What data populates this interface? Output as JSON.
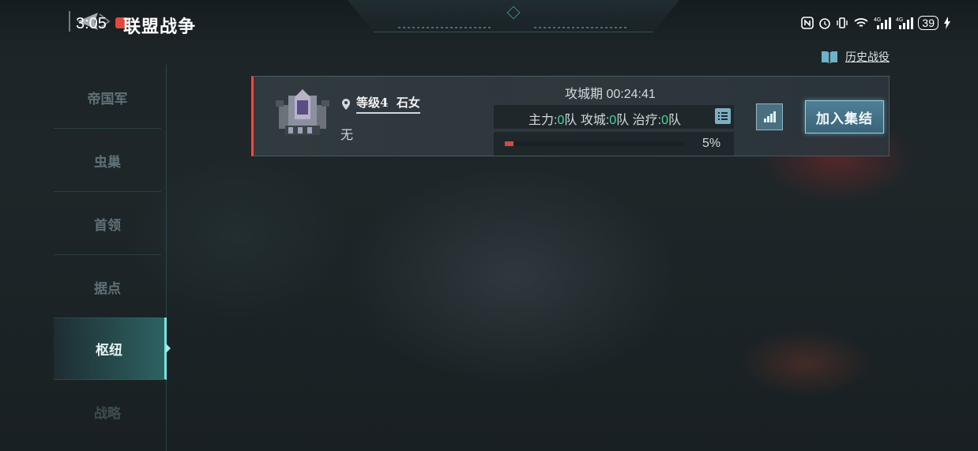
{
  "status_bar": {
    "time": "3:05",
    "battery": "39",
    "icons": [
      "nfc-icon",
      "alarm-icon",
      "vibrate-icon",
      "wifi-icon",
      "signal-4g-icon",
      "signal-4g-icon",
      "charging-icon"
    ]
  },
  "header": {
    "title": "联盟战争",
    "history_label": "历史战役"
  },
  "sidebar": {
    "items": [
      {
        "label": "帝国军",
        "active": false
      },
      {
        "label": "虫巢",
        "active": false
      },
      {
        "label": "首领",
        "active": false
      },
      {
        "label": "据点",
        "active": false
      },
      {
        "label": "枢纽",
        "active": true
      },
      {
        "label": "战略",
        "active": false
      }
    ]
  },
  "battle_card": {
    "level_label": "等级4",
    "target_name": "石女",
    "owner": "无",
    "phase_label": "攻城期",
    "timer": "00:24:41",
    "teams": {
      "main_label": "主力:",
      "main_value": "0",
      "main_unit": "队",
      "siege_label": "攻城:",
      "siege_value": "0",
      "siege_unit": "队",
      "heal_label": "治疗:",
      "heal_value": "0",
      "heal_unit": "队"
    },
    "progress_percent": 5,
    "progress_label": "5%",
    "join_button": "加入集结",
    "accent_color": "#d0574e"
  }
}
